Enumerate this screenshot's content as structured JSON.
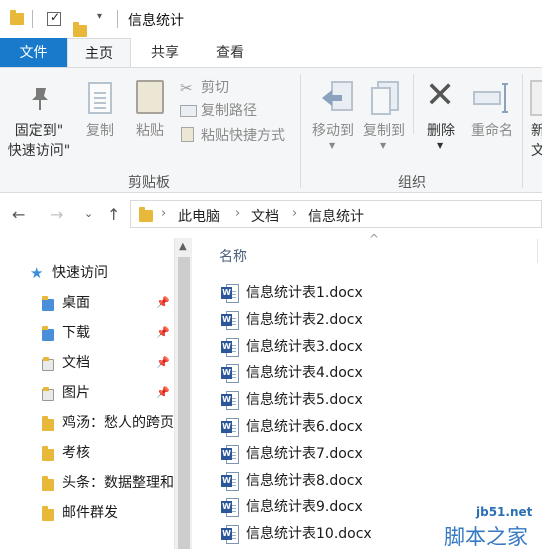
{
  "window": {
    "title": "信息统计"
  },
  "tabs": [
    {
      "label": "文件"
    },
    {
      "label": "主页"
    },
    {
      "label": "共享"
    },
    {
      "label": "查看"
    }
  ],
  "ribbon": {
    "clipboard": {
      "pin_line1": "固定到\"",
      "pin_line2": "快速访问\"",
      "copy": "复制",
      "paste": "粘贴",
      "cut": "剪切",
      "copy_path": "复制路径",
      "paste_shortcut": "粘贴快捷方式",
      "group": "剪贴板"
    },
    "organize": {
      "move_to": "移动到",
      "copy_to": "复制到",
      "delete": "删除",
      "rename": "重命名",
      "group": "组织"
    },
    "new": {
      "partial_line1": "新",
      "partial_line2": "文"
    }
  },
  "address": {
    "crumbs": [
      "此电脑",
      "文档",
      "信息统计"
    ]
  },
  "nav": {
    "quick_access": "快速访问",
    "items": [
      {
        "label": "桌面",
        "pinned": true
      },
      {
        "label": "下载",
        "pinned": true
      },
      {
        "label": "文档",
        "pinned": true
      },
      {
        "label": "图片",
        "pinned": true
      },
      {
        "label": "鸡汤：愁人的跨页",
        "pinned": false
      },
      {
        "label": "考核",
        "pinned": false
      },
      {
        "label": "头条：数据整理和",
        "pinned": false
      },
      {
        "label": "邮件群发",
        "pinned": false
      }
    ]
  },
  "files": {
    "column_name": "名称",
    "items": [
      "信息统计表1.docx",
      "信息统计表2.docx",
      "信息统计表3.docx",
      "信息统计表4.docx",
      "信息统计表5.docx",
      "信息统计表6.docx",
      "信息统计表7.docx",
      "信息统计表8.docx",
      "信息统计表9.docx",
      "信息统计表10.docx"
    ]
  },
  "watermark": {
    "url": "jb51.net",
    "text": "脚本之家"
  },
  "colors": {
    "accent": "#1979ca",
    "folder": "#e8b83b",
    "word": "#2b579a"
  }
}
